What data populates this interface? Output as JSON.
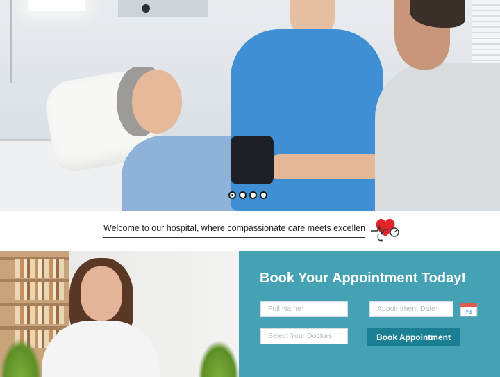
{
  "hero": {
    "slide_count": 4,
    "active_slide": 1
  },
  "welcome": {
    "text": "Welcome to our hospital, where compassionate care meets excellence"
  },
  "calendar": {
    "day": "24"
  },
  "booking": {
    "title": "Book Your Appointment Today!",
    "full_name_placeholder": "Full Name*",
    "date_placeholder": "Appointment Date*",
    "doctor_placeholder": "Select Your Doctors",
    "submit_label": "Book Appointment"
  },
  "colors": {
    "booking_background": "#45a2b4",
    "button": "#1a7f93",
    "heart": "#e0262b"
  }
}
